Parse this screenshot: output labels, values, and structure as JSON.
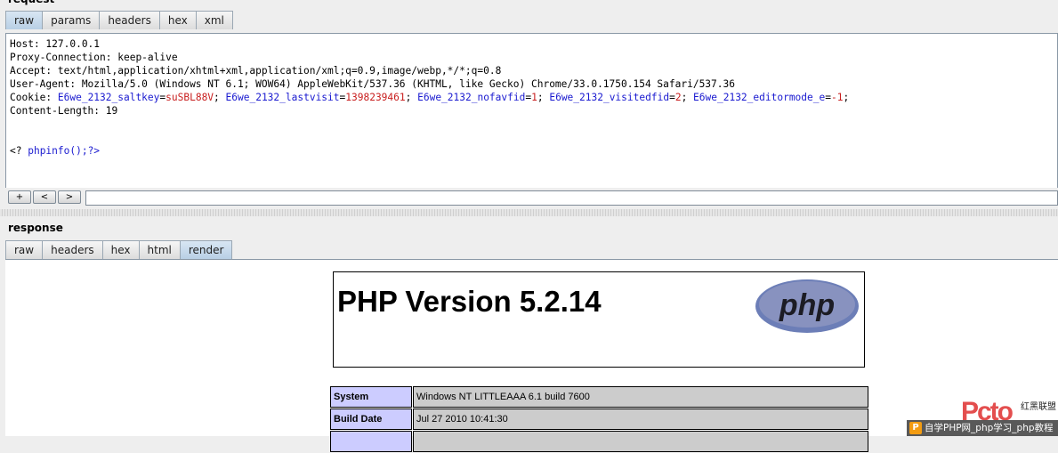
{
  "request": {
    "section_label": "request",
    "tabs": [
      "raw",
      "params",
      "headers",
      "hex",
      "xml"
    ],
    "active_tab": "raw",
    "lines": {
      "host": "Host: 127.0.0.1",
      "proxy": "Proxy-Connection: keep-alive",
      "accept": "Accept: text/html,application/xhtml+xml,application/xml;q=0.9,image/webp,*/*;q=0.8",
      "useragent": "User-Agent: Mozilla/5.0 (Windows NT 6.1; WOW64) AppleWebKit/537.36 (KHTML, like Gecko) Chrome/33.0.1750.154 Safari/537.36",
      "cookie_key": "Cookie: ",
      "c1k": "E6we_2132_saltkey",
      "c1v": "suSBL88V",
      "c2k": "E6we_2132_lastvisit",
      "c2v": "1398239461",
      "c3k": "E6we_2132_nofavfid",
      "c3v": "1",
      "c4k": "E6we_2132_visitedfid",
      "c4v": "2",
      "c5k": "E6we_2132_editormode_e",
      "c5v": "-1",
      "content_length": "Content-Length: 19",
      "body_open": "<? ",
      "body_code": "phpinfo();?>"
    },
    "toolbar": {
      "plus": "+",
      "prev": "<",
      "next": ">",
      "search_value": ""
    }
  },
  "response": {
    "section_label": "response",
    "tabs": [
      "raw",
      "headers",
      "hex",
      "html",
      "render"
    ],
    "active_tab": "render",
    "render": {
      "title": "PHP Version 5.2.14",
      "logo_text": "php",
      "rows": [
        {
          "key": "System",
          "value": "Windows NT LITTLEAAA 6.1 build 7600"
        },
        {
          "key": "Build Date",
          "value": "Jul 27 2010 10:41:30"
        }
      ]
    }
  },
  "watermark": {
    "logo": "Pcto",
    "chinese": "红黑联盟",
    "bar_icon": "P",
    "bar_text": "自学PHP网_php学习_php教程"
  }
}
